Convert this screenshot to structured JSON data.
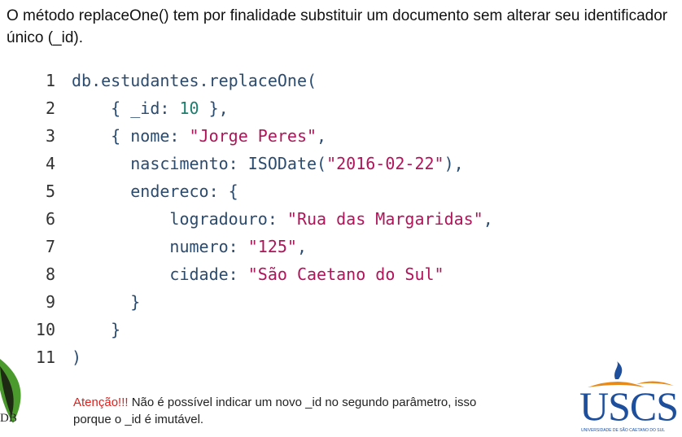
{
  "intro": "O método replaceOne() tem por finalidade substituir um documento sem alterar seu identificador único (_id).",
  "code_lines": [
    {
      "n": "1",
      "segments": [
        {
          "t": "db.estudantes.replaceOne(",
          "c": "kw"
        }
      ]
    },
    {
      "n": "2",
      "segments": [
        {
          "t": "    { _id: ",
          "c": "kw"
        },
        {
          "t": "10",
          "c": "num"
        },
        {
          "t": " },",
          "c": "kw"
        }
      ]
    },
    {
      "n": "3",
      "segments": [
        {
          "t": "    { nome: ",
          "c": "kw"
        },
        {
          "t": "\"Jorge Peres\"",
          "c": "str"
        },
        {
          "t": ",",
          "c": "kw"
        }
      ]
    },
    {
      "n": "4",
      "segments": [
        {
          "t": "      nascimento: ISODate(",
          "c": "kw"
        },
        {
          "t": "\"2016-02-22\"",
          "c": "str"
        },
        {
          "t": "),",
          "c": "kw"
        }
      ]
    },
    {
      "n": "5",
      "segments": [
        {
          "t": "      endereco: {",
          "c": "kw"
        }
      ]
    },
    {
      "n": "6",
      "segments": [
        {
          "t": "          logradouro: ",
          "c": "kw"
        },
        {
          "t": "\"Rua das Margaridas\"",
          "c": "str"
        },
        {
          "t": ",",
          "c": "kw"
        }
      ]
    },
    {
      "n": "7",
      "segments": [
        {
          "t": "          numero: ",
          "c": "kw"
        },
        {
          "t": "\"125\"",
          "c": "str"
        },
        {
          "t": ",",
          "c": "kw"
        }
      ]
    },
    {
      "n": "8",
      "segments": [
        {
          "t": "          cidade: ",
          "c": "kw"
        },
        {
          "t": "\"São Caetano do Sul\"",
          "c": "str"
        }
      ]
    },
    {
      "n": "9",
      "segments": [
        {
          "t": "      }",
          "c": "kw"
        }
      ]
    },
    {
      "n": "10",
      "segments": [
        {
          "t": "    }",
          "c": "kw"
        }
      ]
    },
    {
      "n": "11",
      "segments": [
        {
          "t": ")",
          "c": "kw"
        }
      ]
    }
  ],
  "notice": {
    "warning": "Atenção!!!",
    "text": " Não é possível indicar um novo _id no segundo parâmetro, isso porque o _id é imutável."
  },
  "logos": {
    "left_text": "DB",
    "right_name": "USCS",
    "right_subtitle": "UNIVERSIDADE DE SÃO CAETANO DO SUL"
  },
  "colors": {
    "string": "#b0155a",
    "number": "#1a7f6e",
    "warning": "#e0201c",
    "brand": "#1e4f9c"
  }
}
